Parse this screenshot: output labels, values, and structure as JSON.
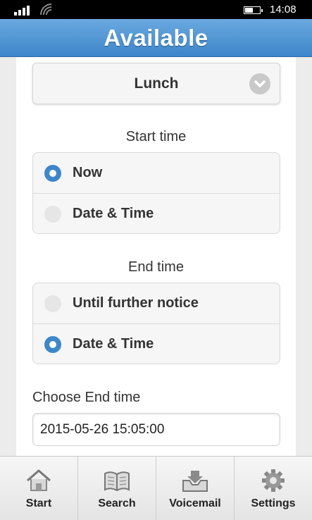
{
  "status_bar": {
    "time": "14:08",
    "battery_level": 0.5,
    "signal_bars": 4
  },
  "header": {
    "title": "Available"
  },
  "reason_select": {
    "value": "Lunch",
    "icon": "chevron-down-icon"
  },
  "start_time": {
    "label": "Start time",
    "options": [
      {
        "label": "Now",
        "selected": true
      },
      {
        "label": "Date & Time",
        "selected": false
      }
    ]
  },
  "end_time": {
    "label": "End time",
    "options": [
      {
        "label": "Until further notice",
        "selected": false
      },
      {
        "label": "Date & Time",
        "selected": true
      }
    ]
  },
  "choose_end_time": {
    "label": "Choose End time",
    "value": "2015-05-26 15:05:00"
  },
  "nav": [
    {
      "label": "Start",
      "icon": "home-icon"
    },
    {
      "label": "Search",
      "icon": "book-icon"
    },
    {
      "label": "Voicemail",
      "icon": "voicemail-inbox-icon"
    },
    {
      "label": "Settings",
      "icon": "gear-icon"
    }
  ],
  "colors": {
    "accent": "#3d86c9",
    "header_top": "#6aa9e0",
    "header_bottom": "#3d86c9"
  }
}
